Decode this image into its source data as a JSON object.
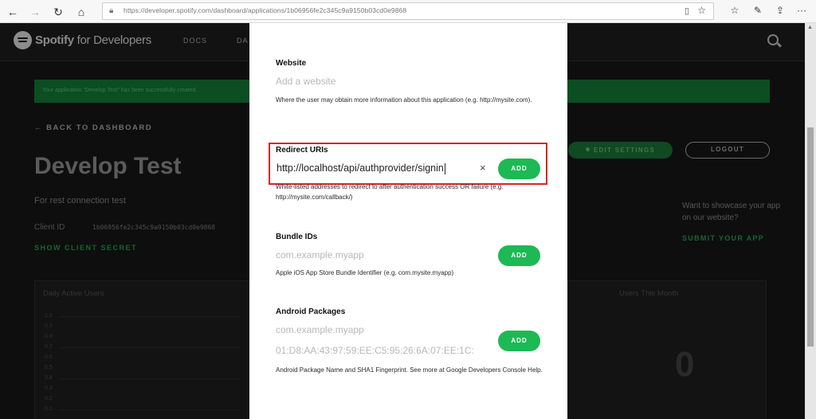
{
  "browser": {
    "url": "https://developer.spotify.com/dashboard/applications/1b06956fe2c345c9a9150b03cd0e9868",
    "back_glyph": "←",
    "forward_glyph": "→",
    "refresh_glyph": "↻",
    "home_glyph": "⌂",
    "lock_glyph": "🔒︎",
    "reader_glyph": "▯",
    "favorite_glyph": "☆",
    "favorites_glyph": "☆",
    "notes_glyph": "✎",
    "share_glyph": "⇪",
    "more_glyph": "···"
  },
  "spotify": {
    "logo_brand": "Spotify",
    "logo_suffix": " for Developers",
    "nav": [
      "DOCS",
      "DA"
    ],
    "banner_text": "Your application \"Develop Test\" has been successfully created.",
    "back_link": "← BACK TO DASHBOARD",
    "app_title": "Develop Test",
    "app_description": "For rest connection test",
    "client_id_label": "Client ID",
    "client_id_value": "1b06956fe2c345c9a9150b03cd0e9868",
    "show_secret": "SHOW CLIENT SECRET",
    "edit_settings": "EDIT SETTINGS",
    "logout": "LOGOUT",
    "showcase_text": "Want to showcase your app on our website?",
    "submit_app": "SUBMIT YOUR APP",
    "daily_users_title": "Daily Active Users",
    "monthly_users_title": "Users This Month",
    "monthly_users_value": "0",
    "chart_ticks": [
      "1.0",
      "0.9",
      "0.8",
      "0.7",
      "0.6",
      "0.5",
      "0.4",
      "0.3",
      "0.2",
      "0.1"
    ]
  },
  "modal": {
    "website": {
      "label": "Website",
      "placeholder": "Add a website",
      "help": "Where the user may obtain more information about this application (e.g. http://mysite.com)."
    },
    "redirect": {
      "label": "Redirect URIs",
      "value": "http://localhost/api/authprovider/signin",
      "clear_glyph": "×",
      "add": "ADD",
      "help": "White-listed addresses to redirect to after authentication success OR failure (e.g. http://mysite.com/callback/)"
    },
    "bundle": {
      "label": "Bundle IDs",
      "placeholder": "com.example.myapp",
      "add": "ADD",
      "help": "Apple iOS App Store Bundle Identifier (e.g. com.mysite.myapp)"
    },
    "android": {
      "label": "Android Packages",
      "placeholder_package": "com.example.myapp",
      "placeholder_fingerprint": "01:D8:AA:43:97:59:EE:C5:95:26:6A:07:EE:1C:",
      "add": "ADD",
      "help": "Android Package Name and SHA1 Fingerprint. See more at Google Developers Console Help."
    }
  },
  "colors": {
    "spotify_green": "#1db954",
    "highlight_red": "#d92424"
  }
}
